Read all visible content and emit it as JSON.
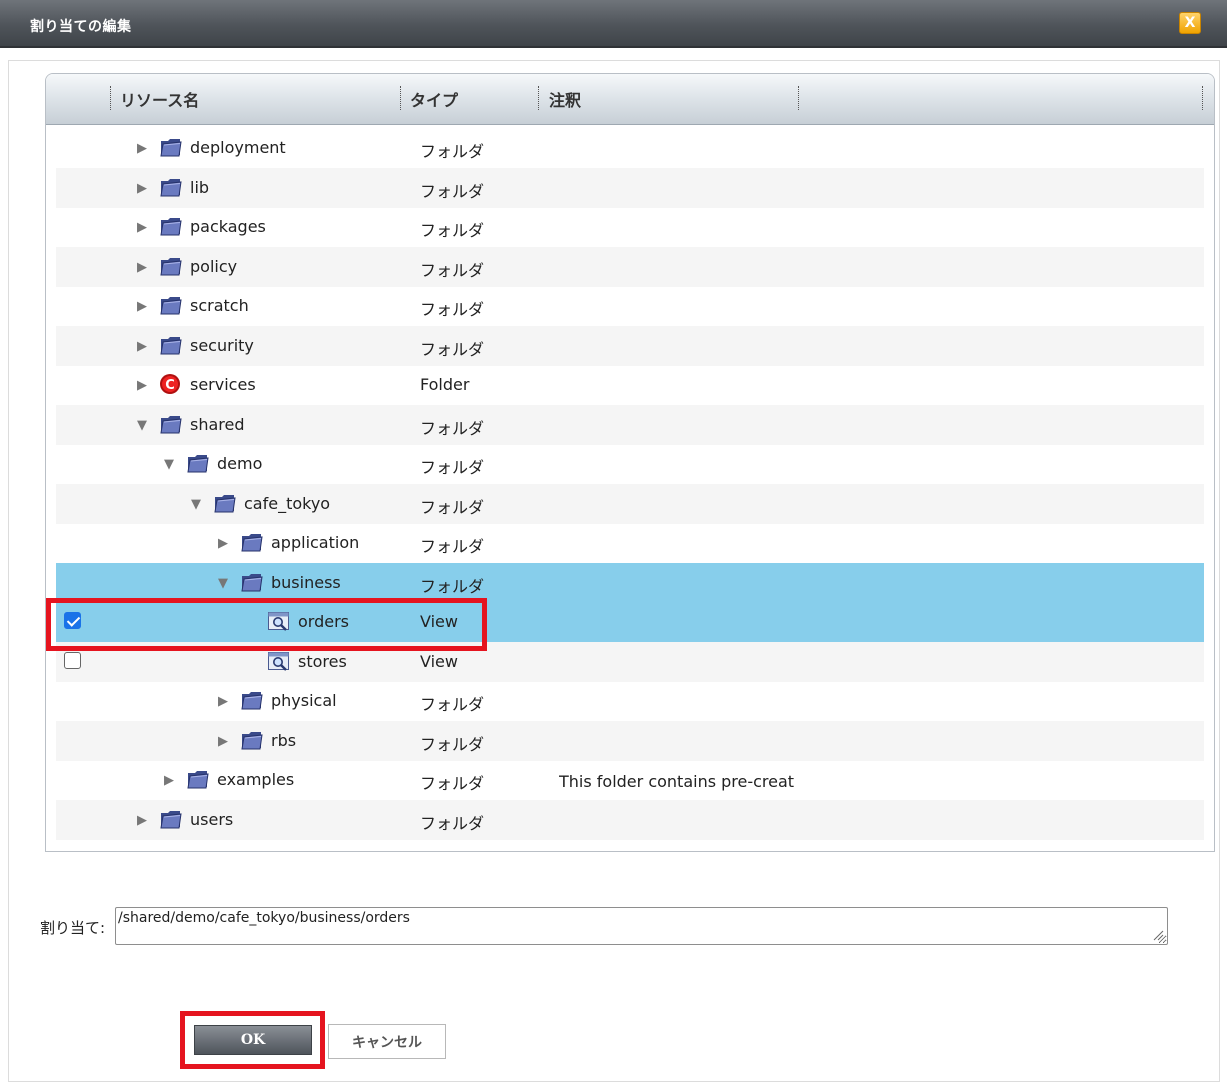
{
  "window": {
    "title": "割り当ての編集",
    "close_label": "X"
  },
  "grid": {
    "columns": [
      "リソース名",
      "タイプ",
      "注釈"
    ],
    "rows": [
      {
        "name": "deployment",
        "type": "フォルダ",
        "note": ""
      },
      {
        "name": "lib",
        "type": "フォルダ",
        "note": ""
      },
      {
        "name": "packages",
        "type": "フォルダ",
        "note": ""
      },
      {
        "name": "policy",
        "type": "フォルダ",
        "note": ""
      },
      {
        "name": "scratch",
        "type": "フォルダ",
        "note": ""
      },
      {
        "name": "security",
        "type": "フォルダ",
        "note": ""
      },
      {
        "name": "services",
        "type": "Folder",
        "note": ""
      },
      {
        "name": "shared",
        "type": "フォルダ",
        "note": ""
      },
      {
        "name": "demo",
        "type": "フォルダ",
        "note": ""
      },
      {
        "name": "cafe_tokyo",
        "type": "フォルダ",
        "note": ""
      },
      {
        "name": "application",
        "type": "フォルダ",
        "note": ""
      },
      {
        "name": "business",
        "type": "フォルダ",
        "note": ""
      },
      {
        "name": "orders",
        "type": "View",
        "note": "",
        "checked": true
      },
      {
        "name": "stores",
        "type": "View",
        "note": "",
        "checked": false
      },
      {
        "name": "physical",
        "type": "フォルダ",
        "note": ""
      },
      {
        "name": "rbs",
        "type": "フォルダ",
        "note": ""
      },
      {
        "name": "examples",
        "type": "フォルダ",
        "note": "This folder contains pre-creat"
      },
      {
        "name": "users",
        "type": "フォルダ",
        "note": ""
      }
    ]
  },
  "assign": {
    "label": "割り当て:",
    "value": "/shared/demo/cafe_tokyo/business/orders"
  },
  "buttons": {
    "ok": "OK",
    "cancel": "キャンセル"
  },
  "colors": {
    "selected_row": "#87ceeb",
    "highlight": "#e5141f",
    "titlebar": "#4f545a"
  }
}
